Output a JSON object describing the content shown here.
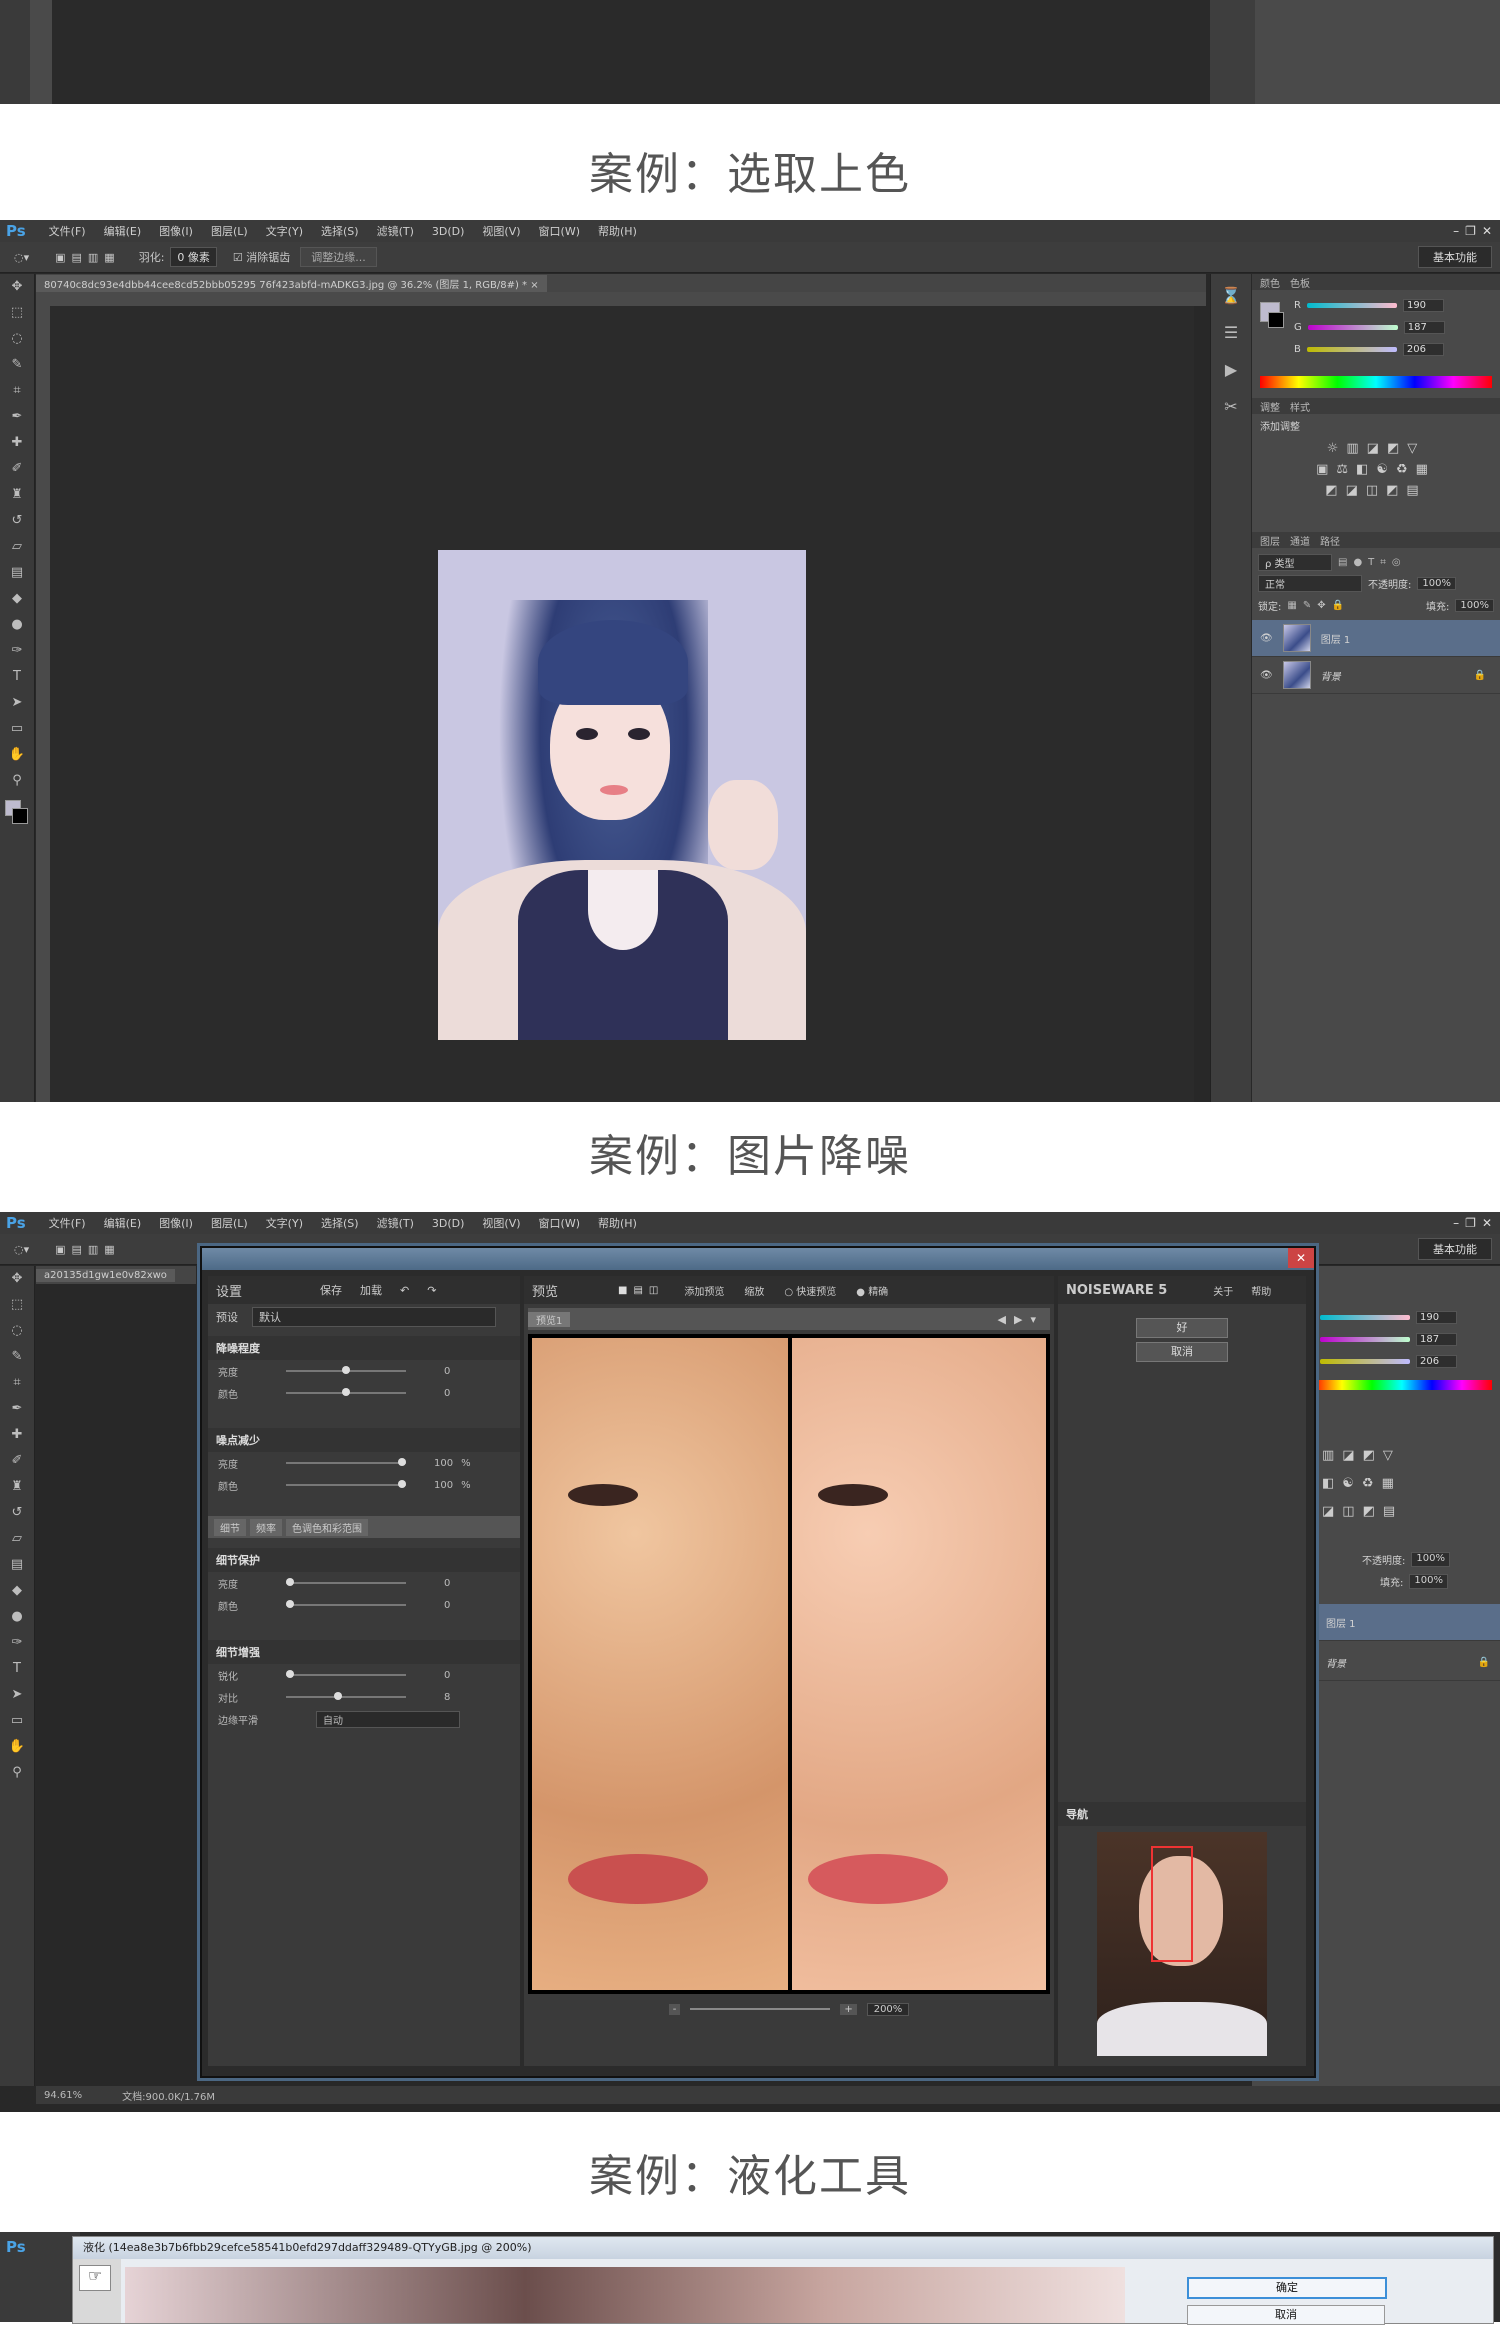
{
  "captions": {
    "case1": "案例：选取上色",
    "case2": "案例：图片降噪",
    "case3": "案例：液化工具"
  },
  "ps": {
    "logo": "Ps",
    "menu": [
      "文件(F)",
      "编辑(E)",
      "图像(I)",
      "图层(L)",
      "文字(Y)",
      "选择(S)",
      "滤镜(T)",
      "3D(D)",
      "视图(V)",
      "窗口(W)",
      "帮助(H)"
    ],
    "window_buttons": [
      "–",
      "❐",
      "✕"
    ],
    "workspace": "基本功能"
  },
  "screen1": {
    "options": {
      "feather_label": "羽化:",
      "feather_value": "0 像素",
      "antialias": "消除锯齿",
      "refine_edge": "调整边缘..."
    },
    "doc_tab": "80740c8dc93e4dbb44cee8cd52bbb05295 76f423abfd-mADKG3.jpg @ 36.2% (图层 1, RGB/8#) *  ×",
    "color_panel": {
      "tabs": [
        "颜色",
        "色板"
      ],
      "channels": [
        {
          "label": "R",
          "value": "190"
        },
        {
          "label": "G",
          "value": "187"
        },
        {
          "label": "B",
          "value": "206"
        }
      ]
    },
    "adjust_panel": {
      "tabs": [
        "调整",
        "样式"
      ],
      "title": "添加调整"
    },
    "layers_panel": {
      "tabs": [
        "图层",
        "通道",
        "路径"
      ],
      "kind": "ρ 类型",
      "blend": "正常",
      "opacity_label": "不透明度:",
      "opacity": "100%",
      "lock_label": "锁定:",
      "fill_label": "填充:",
      "fill": "100%",
      "layers": [
        {
          "name": "图层 1",
          "selected": true
        },
        {
          "name": "背景",
          "selected": false
        }
      ]
    }
  },
  "screen2": {
    "doc_tab": "a20135d1gw1e0v82xwo",
    "status": {
      "zoom": "94.61%",
      "doc": "文档:900.0K/1.76M"
    },
    "noiseware": {
      "settings_title": "设置",
      "save": "保存",
      "load": "加载",
      "preset_label": "预设",
      "preset_value": "默认",
      "sec_noise_level": "降噪程度",
      "sec_noise_reduction": "噪点减少",
      "sec_detail_protect": "细节保护",
      "sec_detail_enhance": "细节增强",
      "row_luma": "亮度",
      "row_color": "颜色",
      "row_sharpen": "锐化",
      "row_contrast": "对比",
      "row_edge": "边缘平滑",
      "edge_value": "自动",
      "v_zero": "0",
      "v_hundred": "100",
      "v_percent": "%",
      "v_eight": "8",
      "subtabs": [
        "细节",
        "频率",
        "色调色和彩范围"
      ],
      "preview_title": "预览",
      "preview_add": "添加预览",
      "preview_scale": "缩放",
      "preview_fast": "快速预览",
      "preview_full": "精确",
      "preview_tab": "预览1",
      "zoom_value": "200%",
      "brand": "NOISEWARE 5",
      "about": "关于",
      "help": "帮助",
      "ok": "好",
      "cancel": "取消",
      "navigator": "导航"
    }
  },
  "screen3": {
    "title": "液化 (14ea8e3b7b6fbb29cefce58541b0efd297ddaff329489-QTYyGB.jpg @ 200%)",
    "ok": "确定",
    "cancel": "取消"
  }
}
